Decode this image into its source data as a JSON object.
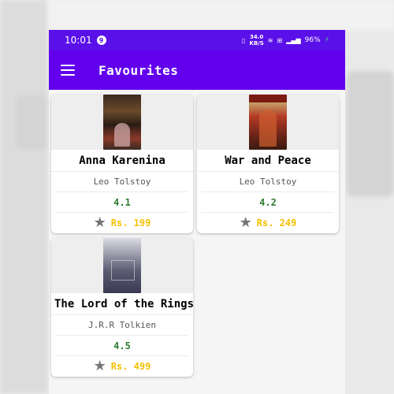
{
  "status_bar": {
    "time": "10:01",
    "notification_count": "9",
    "net_speed_value": "34.0",
    "net_speed_unit": "KB/S",
    "battery": "96%"
  },
  "app_bar": {
    "menu_icon": "hamburger-menu-icon",
    "title": "Favourites"
  },
  "books": [
    {
      "title": "Anna Karenina",
      "author": "Leo Tolstoy",
      "rating": "4.1",
      "price": "Rs. 199"
    },
    {
      "title": "War and Peace",
      "author": "Leo Tolstoy",
      "rating": "4.2",
      "price": "Rs. 249"
    },
    {
      "title": "The Lord of the Rings",
      "author": "J.R.R Tolkien",
      "rating": "4.5",
      "price": "Rs. 499"
    }
  ],
  "colors": {
    "primary": "#6200ee",
    "status_bar": "#5a10e8",
    "rating": "#2e7d32",
    "price": "#f5c000",
    "star": "#757575"
  }
}
